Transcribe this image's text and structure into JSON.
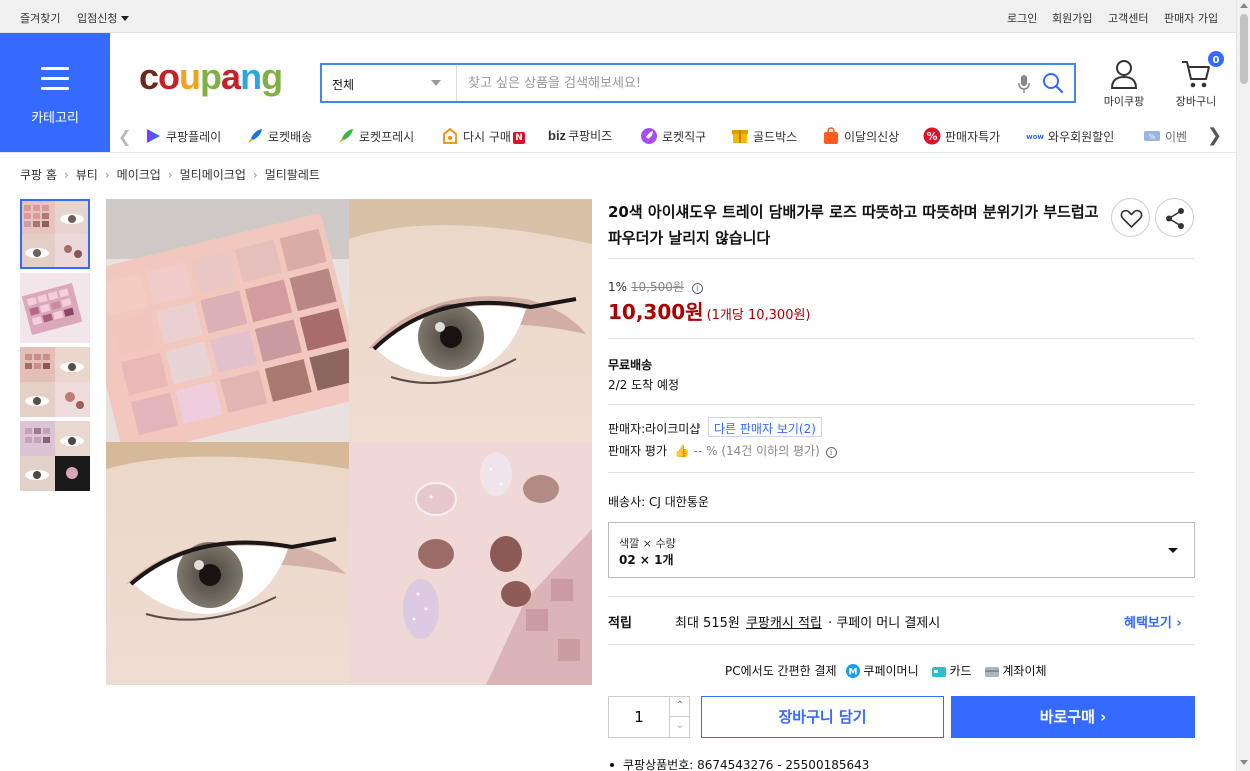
{
  "topbar": {
    "bookmark": "즐겨찾기",
    "store_apply": "입점신청",
    "login": "로그인",
    "signup": "회원가입",
    "customer_center": "고객센터",
    "seller_signup": "판매자 가입"
  },
  "header": {
    "category_label": "카테고리",
    "logo_text": "coupang",
    "logo_colors": [
      "#6a2a1b",
      "#c62127",
      "#f4a21a",
      "#7fb041",
      "#c62127",
      "#2ba6e0",
      "#7fb041"
    ],
    "search_category": "전체",
    "search_placeholder": "찾고 싶은 상품을 검색해보세요!",
    "mycoupang_label": "마이쿠팡",
    "cart_label": "장바구니",
    "cart_count": "0"
  },
  "nav": {
    "items": [
      {
        "label": "쿠팡플레이",
        "icon": "play-icon"
      },
      {
        "label": "로켓배송",
        "icon": "rocket-icon"
      },
      {
        "label": "로켓프레시",
        "icon": "rocket-fresh-icon"
      },
      {
        "label": "다시 구매",
        "icon": "rebuy-icon",
        "badge": "N"
      },
      {
        "label": "쿠팡비즈",
        "icon": "biz-icon",
        "prefix": "biz"
      },
      {
        "label": "로켓직구",
        "icon": "rocket-global-icon"
      },
      {
        "label": "골드박스",
        "icon": "goldbox-icon"
      },
      {
        "label": "이달의신상",
        "icon": "new-bag-icon"
      },
      {
        "label": "판매자특가",
        "icon": "percent-icon"
      },
      {
        "label": "와우회원할인",
        "icon": "wow-icon"
      },
      {
        "label": "이벤",
        "icon": "event-icon"
      }
    ]
  },
  "breadcrumb": [
    "쿠팡 홈",
    "뷰티",
    "메이크업",
    "멀티메이크업",
    "멀티팔레트"
  ],
  "product": {
    "title": "20색 아이섀도우 트레이 담배가루 로즈 따뜻하고 따뜻하며 분위기가 부드럽고 파우더가 날리지 않습니다",
    "discount_rate": "1%",
    "original_price": "10,500원",
    "price": "10,300원",
    "unit_price": "(1개당 10,300원)",
    "shipping_title": "무료배송",
    "shipping_eta": "2/2 도착 예정",
    "seller_label": "판매자:",
    "seller_name": "라이크미샵",
    "other_sellers": "다른 판매자 보기(2)",
    "seller_rating_label": "판매자 평가",
    "seller_rating_value": "-- % (14건 이하의 평가)",
    "carrier_label": "배송사:",
    "carrier_name": "CJ 대한통운",
    "option_header": "색깔 × 수량",
    "option_value": "02 × 1개",
    "reward_label": "적립",
    "reward_text_prefix": "최대 515원",
    "reward_link": "쿠팡캐시 적립",
    "reward_text_suffix": "· 쿠페이 머니 결제시",
    "benefit_link": "혜택보기",
    "pay_label": "PC에서도 간편한 결제",
    "pay_methods": [
      "쿠페이머니",
      "카드",
      "계좌이체"
    ],
    "quantity": "1",
    "add_to_cart": "장바구니 담기",
    "buy_now": "바로구매",
    "product_no": "쿠팡상품번호: 8674543276 - 25500185643"
  },
  "colors": {
    "brand_blue": "#346aff",
    "price_red": "#ae0000"
  }
}
